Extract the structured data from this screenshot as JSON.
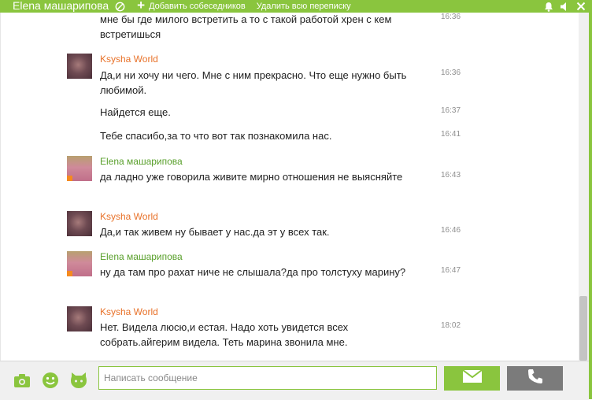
{
  "header": {
    "title": "Elena машарипова",
    "add_label": "Добавить собеседников",
    "delete_label": "Удалить всю переписку"
  },
  "messages": [
    {
      "text": "мне бы где милого встретить а то с такой работой хрен с кем встретишься",
      "time": "16:36"
    },
    {
      "author": "Ksysha World",
      "text": "Да,и ни хочу ни чего. Мне с ним прекрасно.  Что еще нужно быть любимой.",
      "time": "16:36"
    },
    {
      "text": "Найдется еще.",
      "time": "16:37"
    },
    {
      "text": "Тебе спасибо,за то что вот так познакомила нас.",
      "time": "16:41"
    },
    {
      "author": "Elena машарипова",
      "text": "да ладно уже говорила живите мирно отношения не выясняйте",
      "time": "16:43"
    },
    {
      "author": "Ksysha World",
      "text": "Да,и так живем ну бывает у нас.да эт у всех так.",
      "time": "16:46"
    },
    {
      "author": "Elena машарипова",
      "text": "ну да там про рахат ниче не слышала?да про толстуху марину?",
      "time": "16:47"
    },
    {
      "author": "Ksysha World",
      "text": "Нет. Видела люсю,и естая. Надо хоть увидется всех собрать.айгерим видела. Теть марина звонила мне.",
      "time": "18:02"
    }
  ],
  "composer": {
    "placeholder": "Написать сообщение"
  },
  "icons": {
    "block": "block-icon",
    "bell": "bell-icon",
    "sound": "speaker-icon",
    "close": "close-icon",
    "camera": "camera-icon",
    "smile": "smiley-icon",
    "cat": "cat-icon",
    "send": "envelope-icon",
    "call": "phone-icon"
  },
  "colors": {
    "accent": "#8ac53e",
    "author_ksysha": "#e8722a",
    "author_elena": "#5aa02c",
    "call_button": "#7b7b7b"
  }
}
